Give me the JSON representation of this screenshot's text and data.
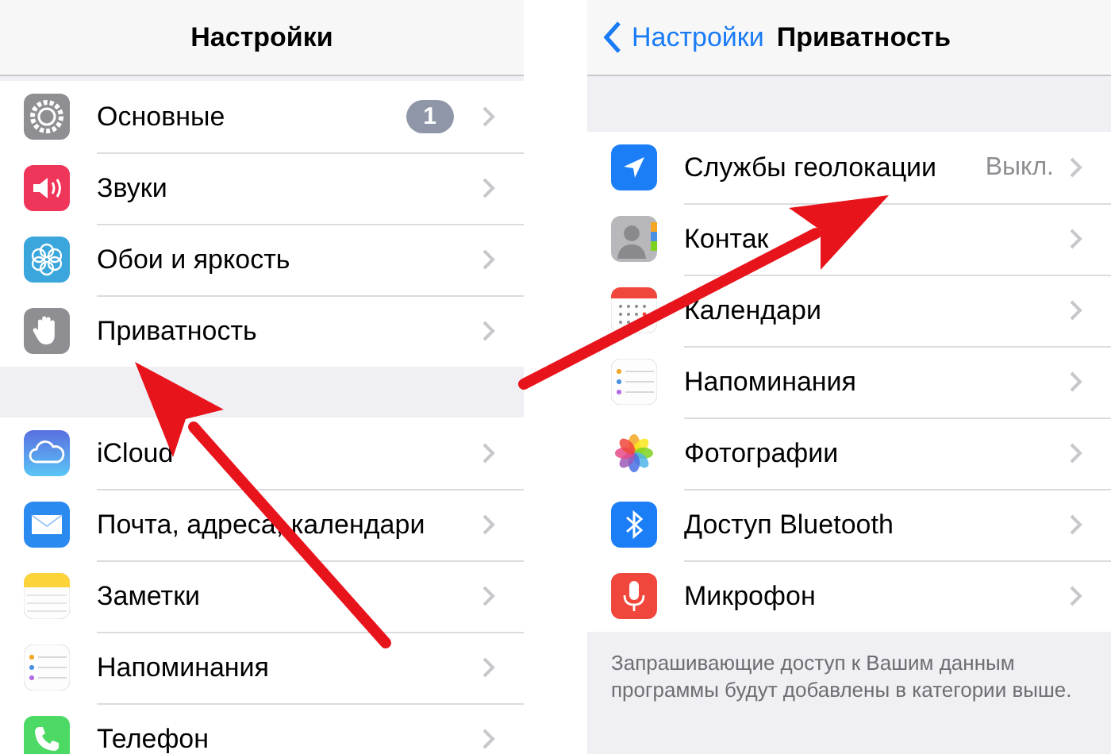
{
  "left_screen": {
    "title": "Настройки",
    "groups": [
      {
        "items": [
          {
            "label": "Основные",
            "badge": "1"
          },
          {
            "label": "Звуки"
          },
          {
            "label": "Обои и яркость"
          },
          {
            "label": "Приватность"
          }
        ]
      },
      {
        "items": [
          {
            "label": "iCloud"
          },
          {
            "label": "Почта, адреса, календари"
          },
          {
            "label": "Заметки"
          },
          {
            "label": "Напоминания"
          },
          {
            "label": "Телефон"
          }
        ]
      }
    ]
  },
  "right_screen": {
    "back": "Настройки",
    "title": "Приватность",
    "items": [
      {
        "label": "Службы геолокации",
        "value": "Выкл."
      },
      {
        "label": "Контак"
      },
      {
        "label": "Календари"
      },
      {
        "label": "Напоминания"
      },
      {
        "label": "Фотографии"
      },
      {
        "label": "Доступ Bluetooth"
      },
      {
        "label": "Микрофон"
      }
    ],
    "footer": "Запрашивающие доступ к Вашим данным программы будут добавлены в категории выше."
  }
}
